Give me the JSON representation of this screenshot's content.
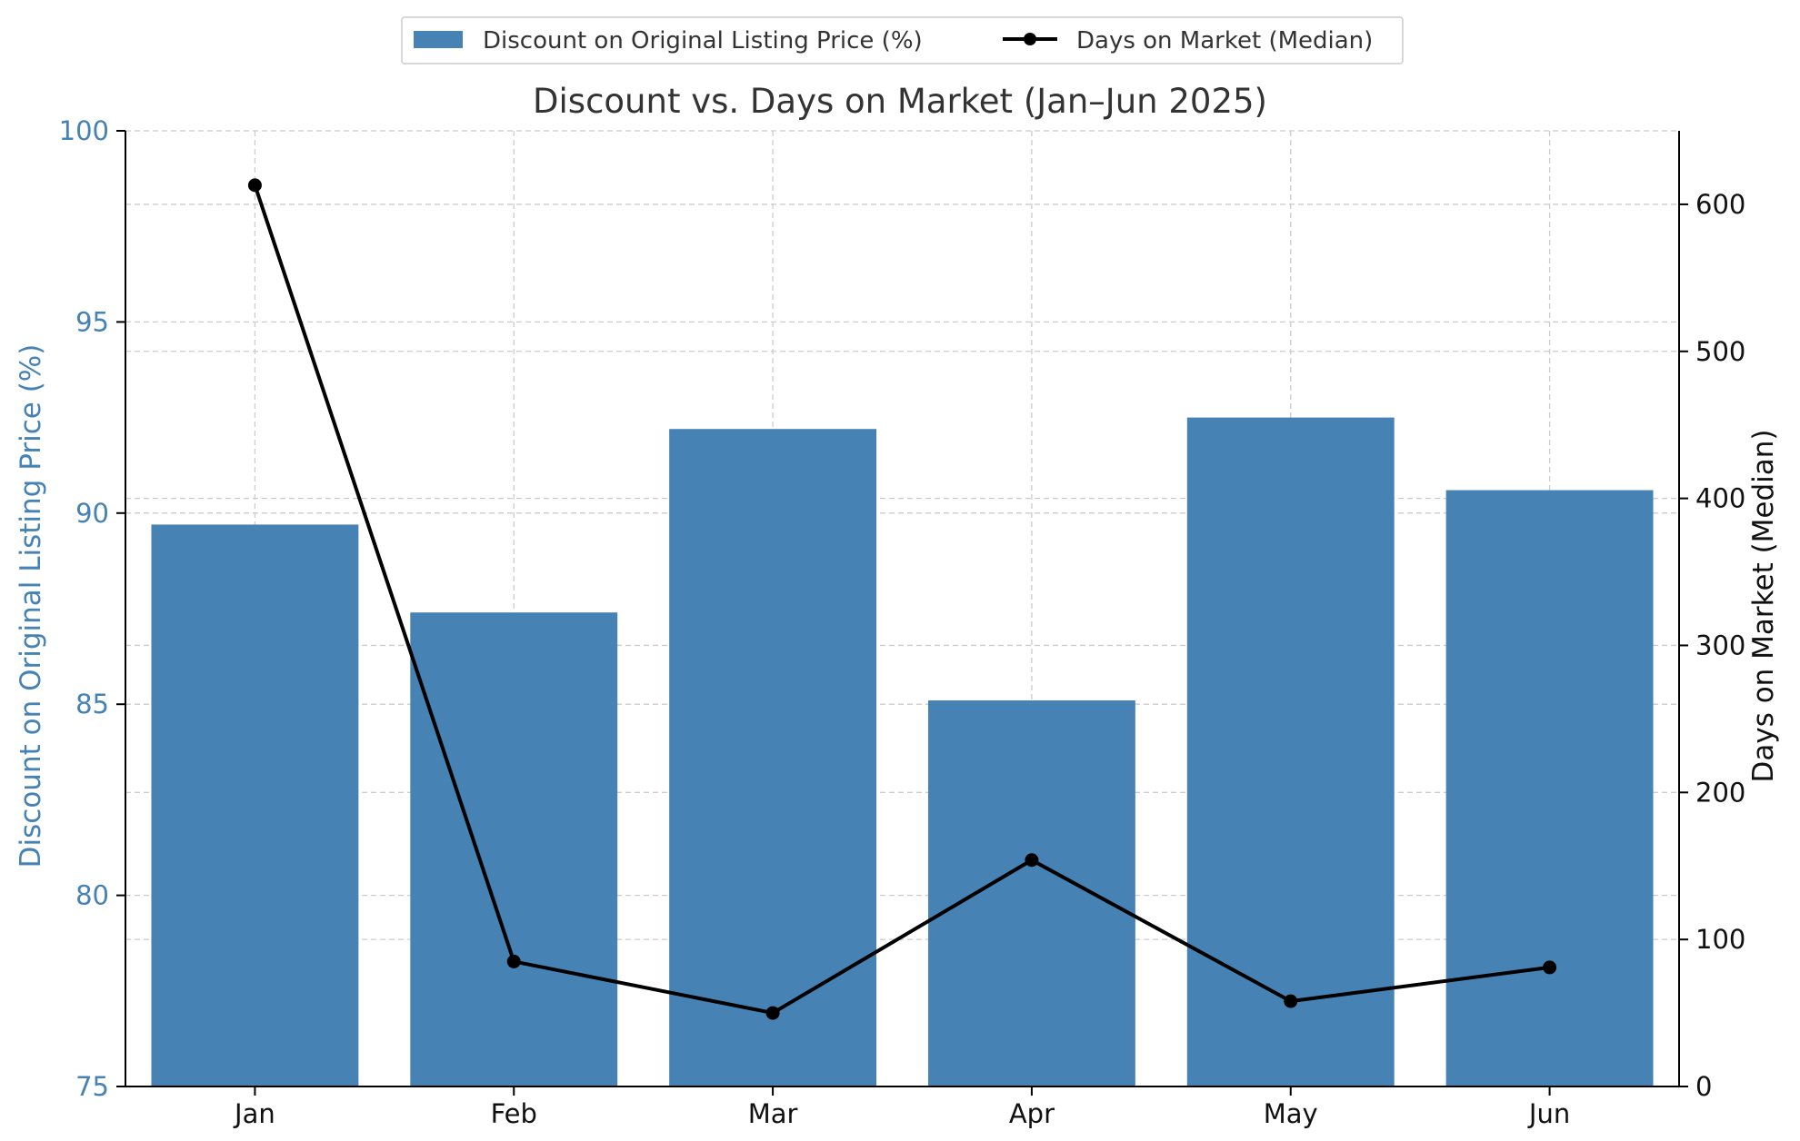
{
  "chart_data": {
    "type": "bar",
    "title": "Discount vs. Days on Market (Jan–Jun 2025)",
    "categories": [
      "Jan",
      "Feb",
      "Mar",
      "Apr",
      "May",
      "Jun"
    ],
    "series": [
      {
        "name": "Discount on Original Listing Price (%)",
        "type": "bar",
        "axis": "left",
        "color": "#4682b4",
        "values": [
          89.7,
          87.4,
          92.2,
          85.1,
          92.5,
          90.6
        ]
      },
      {
        "name": "Days on Market (Median)",
        "type": "line",
        "axis": "right",
        "color": "#000000",
        "values": [
          613,
          85,
          50,
          154,
          58,
          81
        ]
      }
    ],
    "ylabel": "Discount on Original Listing Price (%)",
    "y2label": "Days on Market (Median)",
    "ylim": [
      75,
      100
    ],
    "y2lim": [
      0,
      650
    ],
    "yticks": [
      75,
      80,
      85,
      90,
      95,
      100
    ],
    "y2ticks": [
      0,
      100,
      200,
      300,
      400,
      500,
      600
    ],
    "grid": true,
    "legend_position": "top-center"
  }
}
